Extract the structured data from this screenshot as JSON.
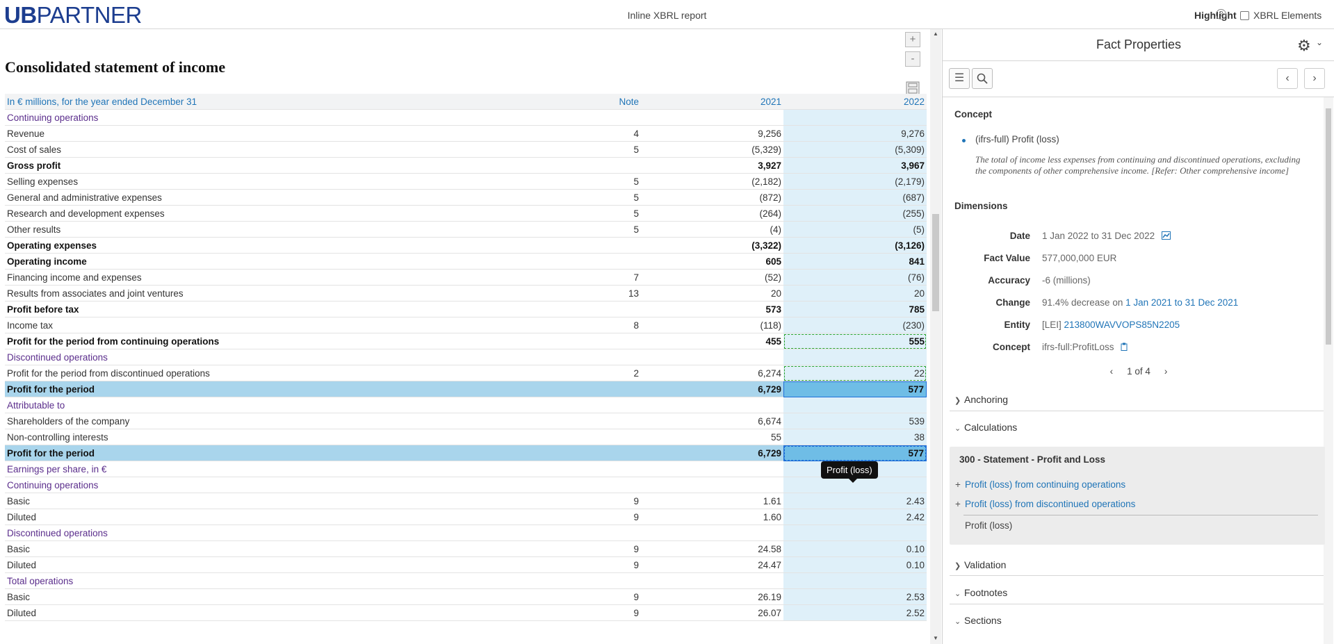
{
  "header": {
    "logo_ub": "UB",
    "logo_partner": "PARTNER",
    "title": "Inline XBRL report",
    "highlight_label": "Highlight",
    "help_glyph": "?",
    "xbrl_elements_label": "XBRL Elements"
  },
  "document": {
    "heading": "Consolidated statement of income",
    "zoom_in": "+",
    "zoom_out": "-",
    "table_header": {
      "label": "In € millions, for the year ended December 31",
      "note": "Note",
      "y1": "2021",
      "y2": "2022"
    },
    "rows": [
      {
        "label": "Continuing operations",
        "note": "",
        "y1": "",
        "y2": "",
        "type": "sec"
      },
      {
        "label": "Revenue",
        "note": "4",
        "y1": "9,256",
        "y2": "9,276",
        "type": ""
      },
      {
        "label": "Cost of sales",
        "note": "5",
        "y1": "(5,329)",
        "y2": "(5,309)",
        "type": ""
      },
      {
        "label": "Gross profit",
        "note": "",
        "y1": "3,927",
        "y2": "3,967",
        "type": "bold"
      },
      {
        "label": "Selling expenses",
        "note": "5",
        "y1": "(2,182)",
        "y2": "(2,179)",
        "type": ""
      },
      {
        "label": "General and administrative expenses",
        "note": "5",
        "y1": "(872)",
        "y2": "(687)",
        "type": ""
      },
      {
        "label": "Research and development expenses",
        "note": "5",
        "y1": "(264)",
        "y2": "(255)",
        "type": ""
      },
      {
        "label": "Other results",
        "note": "5",
        "y1": "(4)",
        "y2": "(5)",
        "type": ""
      },
      {
        "label": "Operating expenses",
        "note": "",
        "y1": "(3,322)",
        "y2": "(3,126)",
        "type": "bold"
      },
      {
        "label": "Operating income",
        "note": "",
        "y1": "605",
        "y2": "841",
        "type": "bold"
      },
      {
        "label": "Financing income and expenses",
        "note": "7",
        "y1": "(52)",
        "y2": "(76)",
        "type": ""
      },
      {
        "label": "Results from associates and joint ventures",
        "note": "13",
        "y1": "20",
        "y2": "20",
        "type": ""
      },
      {
        "label": "Profit before tax",
        "note": "",
        "y1": "573",
        "y2": "785",
        "type": "bold"
      },
      {
        "label": "Income tax",
        "note": "8",
        "y1": "(118)",
        "y2": "(230)",
        "type": ""
      },
      {
        "label": "Profit for the period from continuing operations",
        "note": "",
        "y1": "455",
        "y2": "555",
        "type": "bold",
        "tag": "green"
      },
      {
        "label": "Discontinued operations",
        "note": "",
        "y1": "",
        "y2": "",
        "type": "sec"
      },
      {
        "label": "Profit for the period from discontinued operations",
        "note": "2",
        "y1": "6,274",
        "y2": "22",
        "type": "",
        "tag": "green"
      },
      {
        "label": "Profit for the period",
        "note": "",
        "y1": "6,729",
        "y2": "577",
        "type": "bold sel"
      },
      {
        "label": "Attributable to",
        "note": "",
        "y1": "",
        "y2": "",
        "type": "sec"
      },
      {
        "label": "Shareholders of the company",
        "note": "",
        "y1": "6,674",
        "y2": "539",
        "type": ""
      },
      {
        "label": "Non-controlling interests",
        "note": "",
        "y1": "55",
        "y2": "38",
        "type": ""
      },
      {
        "label": "Profit for the period",
        "note": "",
        "y1": "6,729",
        "y2": "577",
        "type": "bold sel",
        "tag": "blue"
      },
      {
        "label": "Earnings per share, in €",
        "note": "",
        "y1": "",
        "y2": "",
        "type": "sec"
      },
      {
        "label": "Continuing operations",
        "note": "",
        "y1": "",
        "y2": "",
        "type": "sec"
      },
      {
        "label": "Basic",
        "note": "9",
        "y1": "1.61",
        "y2": "2.43",
        "type": ""
      },
      {
        "label": "Diluted",
        "note": "9",
        "y1": "1.60",
        "y2": "2.42",
        "type": ""
      },
      {
        "label": "Discontinued operations",
        "note": "",
        "y1": "",
        "y2": "",
        "type": "sec"
      },
      {
        "label": "Basic",
        "note": "9",
        "y1": "24.58",
        "y2": "0.10",
        "type": ""
      },
      {
        "label": "Diluted",
        "note": "9",
        "y1": "24.47",
        "y2": "0.10",
        "type": ""
      },
      {
        "label": "Total operations",
        "note": "",
        "y1": "",
        "y2": "",
        "type": "sec"
      },
      {
        "label": "Basic",
        "note": "9",
        "y1": "26.19",
        "y2": "2.53",
        "type": ""
      },
      {
        "label": "Diluted",
        "note": "9",
        "y1": "26.07",
        "y2": "2.52",
        "type": ""
      }
    ],
    "tooltip": "Profit (loss)"
  },
  "panel": {
    "title": "Fact Properties",
    "concept_heading": "Concept",
    "concept_name": "(ifrs-full) Profit (loss)",
    "concept_doc": "The total of income less expenses from continuing and discontinued operations, excluding the components of other comprehensive income. [Refer: Other comprehensive income]",
    "dimensions_heading": "Dimensions",
    "date_label": "Date",
    "date_value": "1 Jan 2022 to 31 Dec 2022",
    "fact_value_label": "Fact Value",
    "fact_value": "577,000,000 EUR",
    "accuracy_label": "Accuracy",
    "accuracy_value": "-6 (millions)",
    "change_label": "Change",
    "change_value": "91.4% decrease on",
    "change_period": "1 Jan 2021 to 31 Dec 2021",
    "entity_label": "Entity",
    "entity_scheme": "[LEI]",
    "entity_value": "213800WAVVOPS85N2205",
    "concept_label": "Concept",
    "concept_qname": "ifrs-full:ProfitLoss",
    "pager_text": "1 of 4",
    "anchoring": "Anchoring",
    "calculations": "Calculations",
    "calc_title": "300 - Statement - Profit and Loss",
    "calc_items": [
      "Profit (loss) from continuing operations",
      "Profit (loss) from discontinued operations"
    ],
    "calc_total": "Profit (loss)",
    "validation": "Validation",
    "footnotes": "Footnotes",
    "sections": "Sections"
  },
  "colors": {
    "brand": "#1c3d8f",
    "link": "#1f74b7",
    "section": "#5b2e8c",
    "selected_row": "#a9d5ec"
  }
}
